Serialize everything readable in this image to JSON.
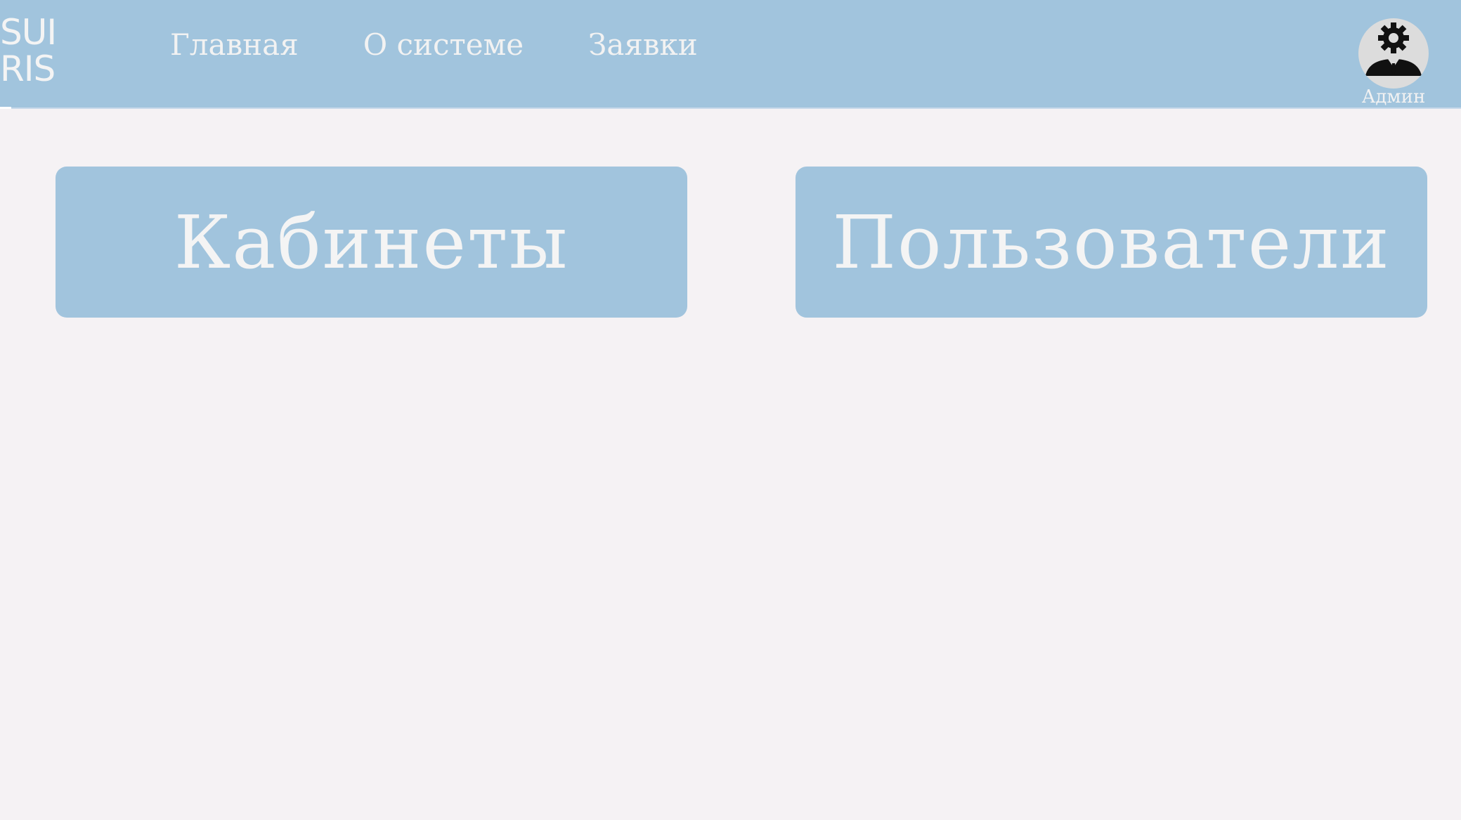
{
  "header": {
    "logo_line1": "SUI",
    "logo_line2": "RIS",
    "nav": [
      {
        "label": "Главная"
      },
      {
        "label": "О системе"
      },
      {
        "label": "Заявки"
      }
    ],
    "user": {
      "label": "Админ",
      "icon": "admin-gear-user-icon"
    }
  },
  "main": {
    "tiles": [
      {
        "label": "Кабинеты"
      },
      {
        "label": "Пользователи"
      }
    ]
  },
  "colors": {
    "header_bg": "#a1c4dd",
    "page_bg": "#f5f2f4",
    "tile_bg": "#a1c4dd",
    "text_light": "#f4f4f4"
  }
}
